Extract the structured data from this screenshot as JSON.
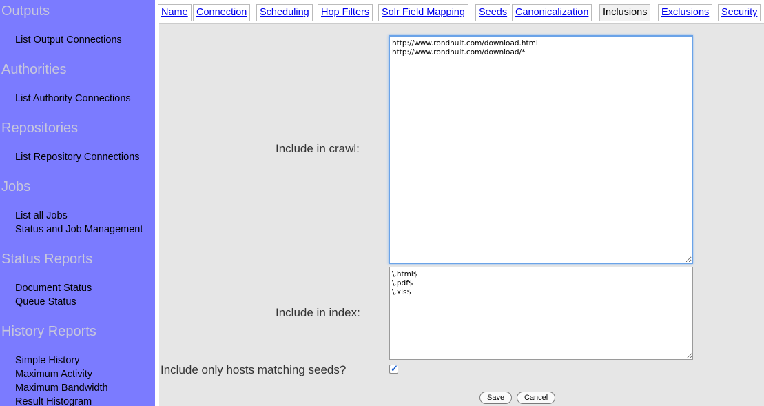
{
  "sidebar": {
    "sections": [
      {
        "title": "Outputs",
        "items": [
          "List Output Connections"
        ]
      },
      {
        "title": "Authorities",
        "items": [
          "List Authority Connections"
        ]
      },
      {
        "title": "Repositories",
        "items": [
          "List Repository Connections"
        ]
      },
      {
        "title": "Jobs",
        "items": [
          "List all Jobs",
          "Status and Job Management"
        ]
      },
      {
        "title": "Status Reports",
        "items": [
          "Document Status",
          "Queue Status"
        ]
      },
      {
        "title": "History Reports",
        "items": [
          "Simple History",
          "Maximum Activity",
          "Maximum Bandwidth",
          "Result Histogram"
        ]
      }
    ]
  },
  "tabs": [
    {
      "label": "Name"
    },
    {
      "label": "Connection"
    },
    {
      "label": "Scheduling"
    },
    {
      "label": "Hop Filters"
    },
    {
      "label": "Solr Field Mapping"
    },
    {
      "label": "Seeds"
    },
    {
      "label": "Canonicalization"
    },
    {
      "label": "Inclusions"
    },
    {
      "label": "Exclusions"
    },
    {
      "label": "Security"
    }
  ],
  "active_tab": "Inclusions",
  "form": {
    "include_crawl_label": "Include in crawl:",
    "include_crawl_value": "http://www.rondhuit.com/download.html\nhttp://www.rondhuit.com/download/*",
    "include_index_label": "Include in index:",
    "include_index_value": "\\.html$\n\\.pdf$\n\\.xls$",
    "hosts_label": "Include only hosts matching seeds?",
    "hosts_checked": true
  },
  "buttons": {
    "save": "Save",
    "cancel": "Cancel"
  },
  "colors": {
    "sidebar_bg": "#7b7bff",
    "section_title": "#c7c7dc",
    "link": "#0000ee",
    "panel_bg": "#e6e6e6"
  }
}
